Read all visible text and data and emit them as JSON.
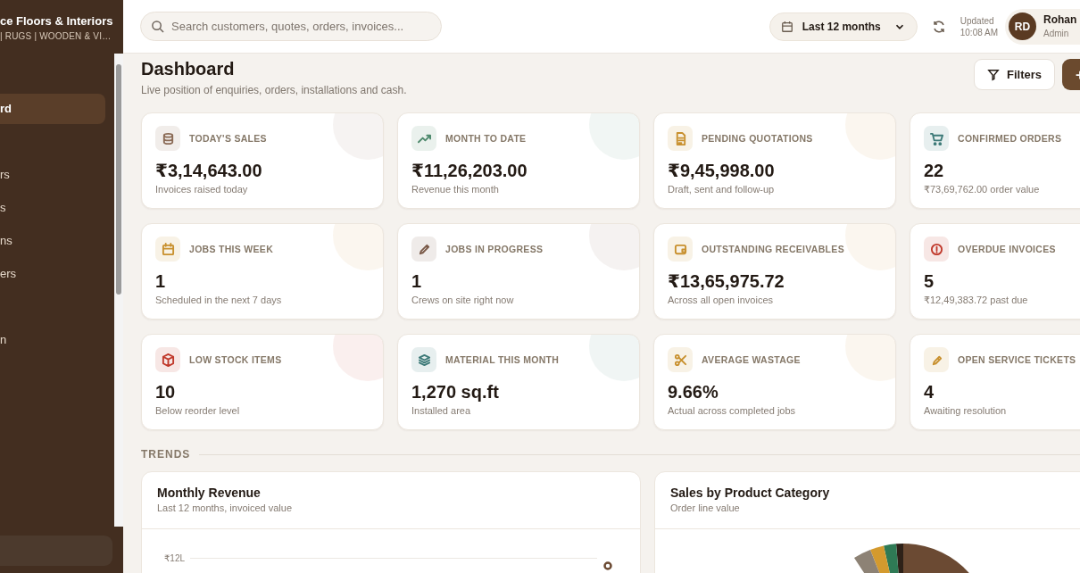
{
  "sidebar": {
    "brand": "ce Floors & Interiors",
    "tagline": "| RUGS | WOODEN & VI…",
    "items": [
      {
        "label": "rd",
        "selected": true
      },
      {
        "label": "rs",
        "selected": false
      },
      {
        "label": "s",
        "selected": false
      },
      {
        "label": "ns",
        "selected": false
      },
      {
        "label": "ers",
        "selected": false
      },
      {
        "label": "n",
        "selected": false
      }
    ]
  },
  "topbar": {
    "search": {
      "placeholder": "Search customers, quotes, orders, invoices..."
    },
    "period": "Last 12 months",
    "updated_label": "Updated",
    "updated_time": "10:08 AM",
    "user": {
      "initials": "RD",
      "name": "Rohan",
      "role": "Admin"
    }
  },
  "page": {
    "title": "Dashboard",
    "subtitle": "Live position of enquiries, orders, installations and cash.",
    "filters_button": "Filters"
  },
  "cards": [
    {
      "label": "TODAY'S SALES",
      "value": "₹3,14,643.00",
      "note": "Invoices raised today",
      "color": "#8a6a55"
    },
    {
      "label": "MONTH TO DATE",
      "value": "₹11,26,203.00",
      "note": "Revenue this month",
      "color": "#4f8a6e"
    },
    {
      "label": "PENDING QUOTATIONS",
      "value": "₹9,45,998.00",
      "note": "Draft, sent and follow-up",
      "color": "#c8902e"
    },
    {
      "label": "CONFIRMED ORDERS",
      "value": "22",
      "note": "₹73,69,762.00 order value",
      "color": "#3d7a78"
    },
    {
      "label": "JOBS THIS WEEK",
      "value": "1",
      "note": "Scheduled in the next 7 days",
      "color": "#c8902e"
    },
    {
      "label": "JOBS IN PROGRESS",
      "value": "1",
      "note": "Crews on site right now",
      "color": "#7a5a48"
    },
    {
      "label": "OUTSTANDING RECEIVABLES",
      "value": "₹13,65,975.72",
      "note": "Across all open invoices",
      "color": "#c8902e"
    },
    {
      "label": "OVERDUE INVOICES",
      "value": "5",
      "note": "₹12,49,383.72 past due",
      "color": "#c0392b"
    },
    {
      "label": "LOW STOCK ITEMS",
      "value": "10",
      "note": "Below reorder level",
      "color": "#c0392b"
    },
    {
      "label": "MATERIAL THIS MONTH",
      "value": "1,270 sq.ft",
      "note": "Installed area",
      "color": "#3d7a78"
    },
    {
      "label": "AVERAGE WASTAGE",
      "value": "9.66%",
      "note": "Actual across completed jobs",
      "color": "#c8902e"
    },
    {
      "label": "OPEN SERVICE TICKETS",
      "value": "4",
      "note": "Awaiting resolution",
      "color": "#c8902e"
    }
  ],
  "trends": {
    "heading": "TRENDS",
    "panels": [
      {
        "kind": "line",
        "title": "Monthly Revenue",
        "subtitle": "Last 12 months, invoiced value",
        "tick_label": "₹12L"
      },
      {
        "kind": "pie",
        "title": "Sales by Product Category",
        "subtitle": "Order line value"
      }
    ]
  }
}
